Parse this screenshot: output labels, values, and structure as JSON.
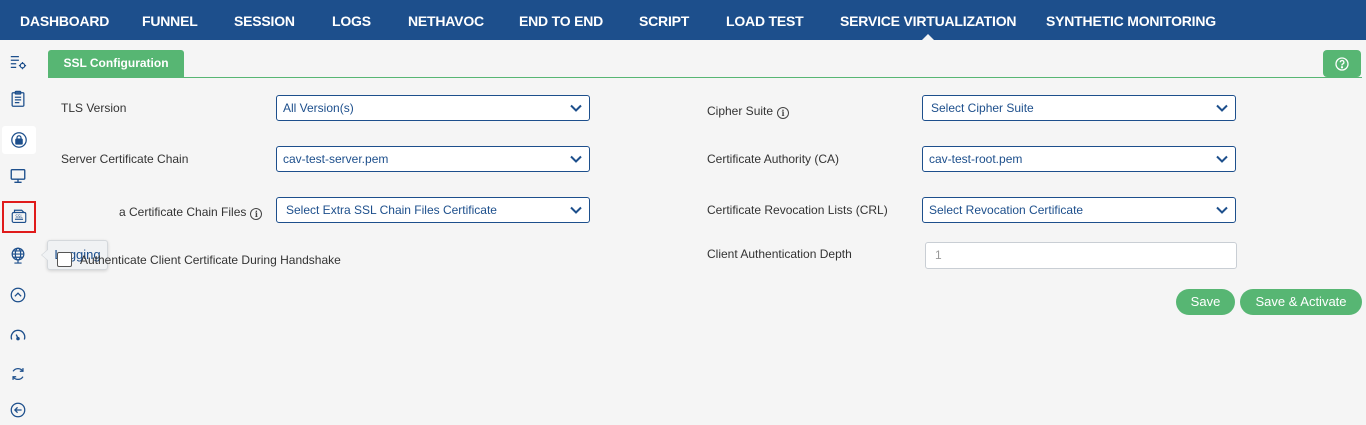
{
  "topnav": {
    "items": [
      "DASHBOARD",
      "FUNNEL",
      "SESSION",
      "LOGS",
      "NETHAVOC",
      "END TO END",
      "SCRIPT",
      "LOAD TEST",
      "SERVICE VIRTUALIZATION",
      "SYNTHETIC MONITORING"
    ],
    "active": "SERVICE VIRTUALIZATION"
  },
  "sidebar": {
    "icons": [
      "settings-list-icon",
      "clipboard-icon",
      "lock-icon",
      "monitor-icon",
      "ssl-document-icon",
      "globe-network-icon",
      "chevron-up-circle-icon",
      "gauge-icon",
      "cycle-icon",
      "back-arrow-circle-icon"
    ],
    "tooltip": "Logging"
  },
  "tab": {
    "label": "SSL Configuration"
  },
  "form": {
    "tls_version_label": "TLS Version",
    "tls_version_value": "All Version(s)",
    "server_cert_label": "Server Certificate Chain",
    "server_cert_value": "cav-test-server.pem",
    "extra_chain_label": "Extra Certificate Chain Files",
    "extra_chain_visible": "a Certificate Chain Files",
    "extra_chain_value": "Select Extra SSL Chain Files Certificate",
    "auth_client_label": "Authenticate Client Certificate During Handshake",
    "cipher_suite_label": "Cipher Suite",
    "cipher_suite_value": "Select Cipher Suite",
    "ca_label": "Certificate Authority (CA)",
    "ca_value": "cav-test-root.pem",
    "crl_label": "Certificate Revocation Lists (CRL)",
    "crl_value": "Select Revocation Certificate",
    "depth_label": "Client Authentication Depth",
    "depth_placeholder": "1"
  },
  "buttons": {
    "save": "Save",
    "save_activate": "Save & Activate"
  },
  "colors": {
    "nav": "#1d4f8c",
    "accent": "#57b673",
    "highlight": "#e01b1b"
  }
}
